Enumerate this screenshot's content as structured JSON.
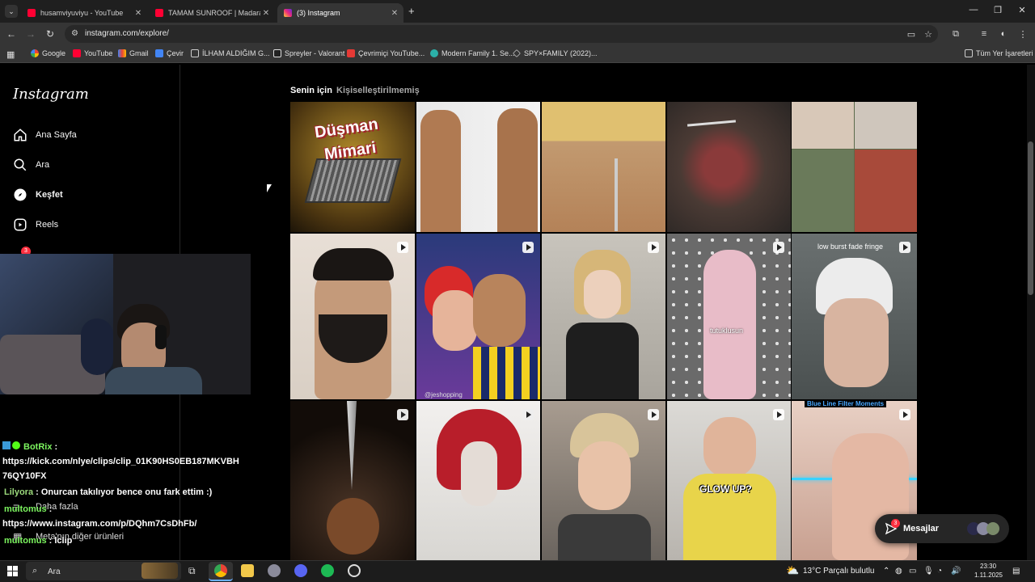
{
  "browser": {
    "tabs": [
      {
        "title": "husamviyuviyu - YouTube",
        "icon": "youtube-icon",
        "color": "#ff0033"
      },
      {
        "title": "TAMAM SUNROOF | Madara Ol",
        "icon": "youtube-icon",
        "color": "#ff0033"
      },
      {
        "title": "(3) Instagram",
        "icon": "instagram-icon",
        "color": "#e1306c"
      }
    ],
    "url": "instagram.com/explore/",
    "bookmarks": [
      {
        "label": "Google",
        "icon": "google-icon"
      },
      {
        "label": "YouTube",
        "icon": "youtube-icon"
      },
      {
        "label": "Gmail",
        "icon": "gmail-icon"
      },
      {
        "label": "Çevir",
        "icon": "translate-icon"
      },
      {
        "label": "İLHAM ALDIĞIM G...",
        "icon": "folder-icon"
      },
      {
        "label": "Spreyler - Valorant",
        "icon": "valorant-icon"
      },
      {
        "label": "Çevrimiçi YouTube...",
        "icon": "youtube-icon"
      },
      {
        "label": "Modern Family 1. Se...",
        "icon": "site-icon"
      },
      {
        "label": "SPY×FAMILY (2022)...",
        "icon": "site-icon"
      }
    ],
    "all_bookmarks": "Tüm Yer İşaretleri"
  },
  "instagram": {
    "logo": "Instagram",
    "nav": [
      {
        "label": "Ana Sayfa",
        "icon": "home-icon"
      },
      {
        "label": "Ara",
        "icon": "search-icon"
      },
      {
        "label": "Keşfet",
        "icon": "compass-icon"
      },
      {
        "label": "Reels",
        "icon": "reels-icon"
      }
    ],
    "notif_badge": "3",
    "more": "Daha fazla",
    "meta": "Meta'nın diğer ürünleri",
    "feed_tabs": [
      "Senin için",
      "Kişiselleştirilmemiş"
    ],
    "tile_texts": {
      "dusman": "Düşman",
      "mimari": "Mimari",
      "tutuklusun": "tutuklusun",
      "fringe": "low burst fade fringe",
      "watermark": "@jeshopping",
      "glowup": "GLOW UP?",
      "filter": "Blue Line Filter Moments"
    },
    "messages": {
      "label": "Mesajlar",
      "badge": "3"
    }
  },
  "chat": [
    {
      "user": "BotRix",
      "sep": " :",
      "color": "#7cf55f"
    },
    {
      "text": "https://kick.com/nlye/clips/clip_01K90HS0EB187MKVBH"
    },
    {
      "text": "76QY10FX"
    },
    {
      "user": "Lilyora",
      "sep": " : Onurcan takılıyor bence onu fark ettim :)",
      "color": "#9bd97b"
    },
    {
      "user": "multomus",
      "sep": " :",
      "color": "#7cf55f"
    },
    {
      "text": "https://www.instagram.com/p/DQhm7CsDhFb/"
    },
    {
      "user": "multomus",
      "sep": " : lclip",
      "color": "#7cf55f"
    }
  ],
  "taskbar": {
    "search": "Ara",
    "weather": "13°C  Parçalı bulutlu",
    "time": "23:30",
    "date": "1.11.2025"
  }
}
